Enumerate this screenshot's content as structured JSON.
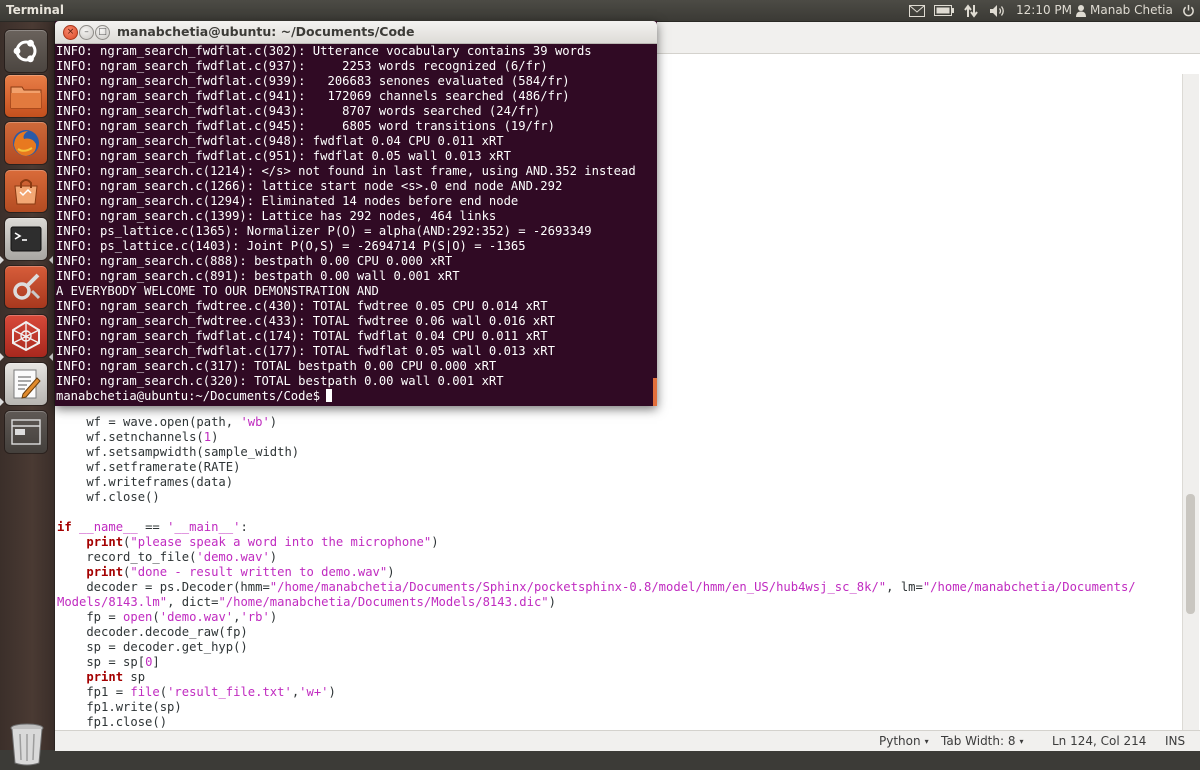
{
  "panel": {
    "app_title": "Terminal",
    "clock": "12:10 PM",
    "user": "Manab Chetia"
  },
  "launcher": {
    "items": [
      {
        "name": "dash-home",
        "icon": "ubuntu-logo-icon"
      },
      {
        "name": "files",
        "icon": "folder-icon"
      },
      {
        "name": "firefox",
        "icon": "firefox-icon"
      },
      {
        "name": "software-center",
        "icon": "shopping-bag-icon"
      },
      {
        "name": "terminal",
        "icon": "terminal-icon"
      },
      {
        "name": "system-settings",
        "icon": "settings-wrench-icon"
      },
      {
        "name": "unknown-app",
        "icon": "web-icon"
      },
      {
        "name": "text-editor",
        "icon": "text-editor-icon"
      },
      {
        "name": "workspace-switcher",
        "icon": "workspace-icon"
      },
      {
        "name": "trash",
        "icon": "trash-icon"
      }
    ]
  },
  "terminal": {
    "title": "manabchetia@ubuntu: ~/Documents/Code",
    "lines": [
      "INFO: ngram_search_fwdflat.c(302): Utterance vocabulary contains 39 words",
      "INFO: ngram_search_fwdflat.c(937):     2253 words recognized (6/fr)",
      "INFO: ngram_search_fwdflat.c(939):   206683 senones evaluated (584/fr)",
      "INFO: ngram_search_fwdflat.c(941):   172069 channels searched (486/fr)",
      "INFO: ngram_search_fwdflat.c(943):     8707 words searched (24/fr)",
      "INFO: ngram_search_fwdflat.c(945):     6805 word transitions (19/fr)",
      "INFO: ngram_search_fwdflat.c(948): fwdflat 0.04 CPU 0.011 xRT",
      "INFO: ngram_search_fwdflat.c(951): fwdflat 0.05 wall 0.013 xRT",
      "INFO: ngram_search.c(1214): </s> not found in last frame, using AND.352 instead",
      "INFO: ngram_search.c(1266): lattice start node <s>.0 end node AND.292",
      "INFO: ngram_search.c(1294): Eliminated 14 nodes before end node",
      "INFO: ngram_search.c(1399): Lattice has 292 nodes, 464 links",
      "INFO: ps_lattice.c(1365): Normalizer P(O) = alpha(AND:292:352) = -2693349",
      "INFO: ps_lattice.c(1403): Joint P(O,S) = -2694714 P(S|O) = -1365",
      "INFO: ngram_search.c(888): bestpath 0.00 CPU 0.000 xRT",
      "INFO: ngram_search.c(891): bestpath 0.00 wall 0.001 xRT",
      "A EVERYBODY WELCOME TO OUR DEMONSTRATION AND",
      "INFO: ngram_search_fwdtree.c(430): TOTAL fwdtree 0.05 CPU 0.014 xRT",
      "INFO: ngram_search_fwdtree.c(433): TOTAL fwdtree 0.06 wall 0.016 xRT",
      "INFO: ngram_search_fwdflat.c(174): TOTAL fwdflat 0.04 CPU 0.011 xRT",
      "INFO: ngram_search_fwdflat.c(177): TOTAL fwdflat 0.05 wall 0.013 xRT",
      "INFO: ngram_search.c(317): TOTAL bestpath 0.00 CPU 0.000 xRT",
      "INFO: ngram_search.c(320): TOTAL bestpath 0.00 wall 0.001 xRT"
    ],
    "prompt": "manabchetia@ubuntu:~/Documents/Code$"
  },
  "editor": {
    "code_lines": [
      [
        {
          "t": "    wf = wave.open(path, "
        },
        {
          "t": "'wb'",
          "c": "str"
        },
        {
          "t": ")"
        }
      ],
      [
        {
          "t": "    wf.setnchannels("
        },
        {
          "t": "1",
          "c": "num"
        },
        {
          "t": ")"
        }
      ],
      [
        {
          "t": "    wf.setsampwidth(sample_width)"
        }
      ],
      [
        {
          "t": "    wf.setframerate(RATE)"
        }
      ],
      [
        {
          "t": "    wf.writeframes(data)"
        }
      ],
      [
        {
          "t": "    wf.close()"
        }
      ],
      [
        {
          "t": ""
        }
      ],
      [
        {
          "t": "if",
          "c": "kw"
        },
        {
          "t": " "
        },
        {
          "t": "__name__",
          "c": "dunder"
        },
        {
          "t": " == "
        },
        {
          "t": "'__main__'",
          "c": "str"
        },
        {
          "t": ":"
        }
      ],
      [
        {
          "t": "    "
        },
        {
          "t": "print",
          "c": "kw"
        },
        {
          "t": "("
        },
        {
          "t": "\"please speak a word into the microphone\"",
          "c": "str"
        },
        {
          "t": ")"
        }
      ],
      [
        {
          "t": "    record_to_file("
        },
        {
          "t": "'demo.wav'",
          "c": "str"
        },
        {
          "t": ")"
        }
      ],
      [
        {
          "t": "    "
        },
        {
          "t": "print",
          "c": "kw"
        },
        {
          "t": "("
        },
        {
          "t": "\"done - result written to demo.wav\"",
          "c": "str"
        },
        {
          "t": ")"
        }
      ],
      [
        {
          "t": "    decoder = ps.Decoder(hmm="
        },
        {
          "t": "\"/home/manabchetia/Documents/Sphinx/pocketsphinx-0.8/model/hmm/en_US/hub4wsj_sc_8k/\"",
          "c": "str"
        },
        {
          "t": ", lm="
        },
        {
          "t": "\"/home/manabchetia/Documents/",
          "c": "str"
        }
      ],
      [
        {
          "t": "Models/8143.lm\"",
          "c": "str"
        },
        {
          "t": ", dict="
        },
        {
          "t": "\"/home/manabchetia/Documents/Models/8143.dic\"",
          "c": "str"
        },
        {
          "t": ")"
        }
      ],
      [
        {
          "t": "    fp = "
        },
        {
          "t": "open",
          "c": "bi"
        },
        {
          "t": "("
        },
        {
          "t": "'demo.wav'",
          "c": "str"
        },
        {
          "t": ","
        },
        {
          "t": "'rb'",
          "c": "str"
        },
        {
          "t": ")"
        }
      ],
      [
        {
          "t": "    decoder.decode_raw(fp)"
        }
      ],
      [
        {
          "t": "    sp = decoder.get_hyp()"
        }
      ],
      [
        {
          "t": "    sp = sp["
        },
        {
          "t": "0",
          "c": "num"
        },
        {
          "t": "]"
        }
      ],
      [
        {
          "t": "    "
        },
        {
          "t": "print",
          "c": "kw"
        },
        {
          "t": " sp"
        }
      ],
      [
        {
          "t": "    fp1 = "
        },
        {
          "t": "file",
          "c": "bi"
        },
        {
          "t": "("
        },
        {
          "t": "'result_file.txt'",
          "c": "str"
        },
        {
          "t": ","
        },
        {
          "t": "'w+'",
          "c": "str"
        },
        {
          "t": ")"
        }
      ],
      [
        {
          "t": "    fp1.write(sp)"
        }
      ],
      [
        {
          "t": "    fp1.close()"
        }
      ]
    ],
    "status": {
      "language": "Python",
      "tab_width": "Tab Width: 8",
      "position": "Ln 124, Col 214",
      "mode": "INS"
    }
  }
}
